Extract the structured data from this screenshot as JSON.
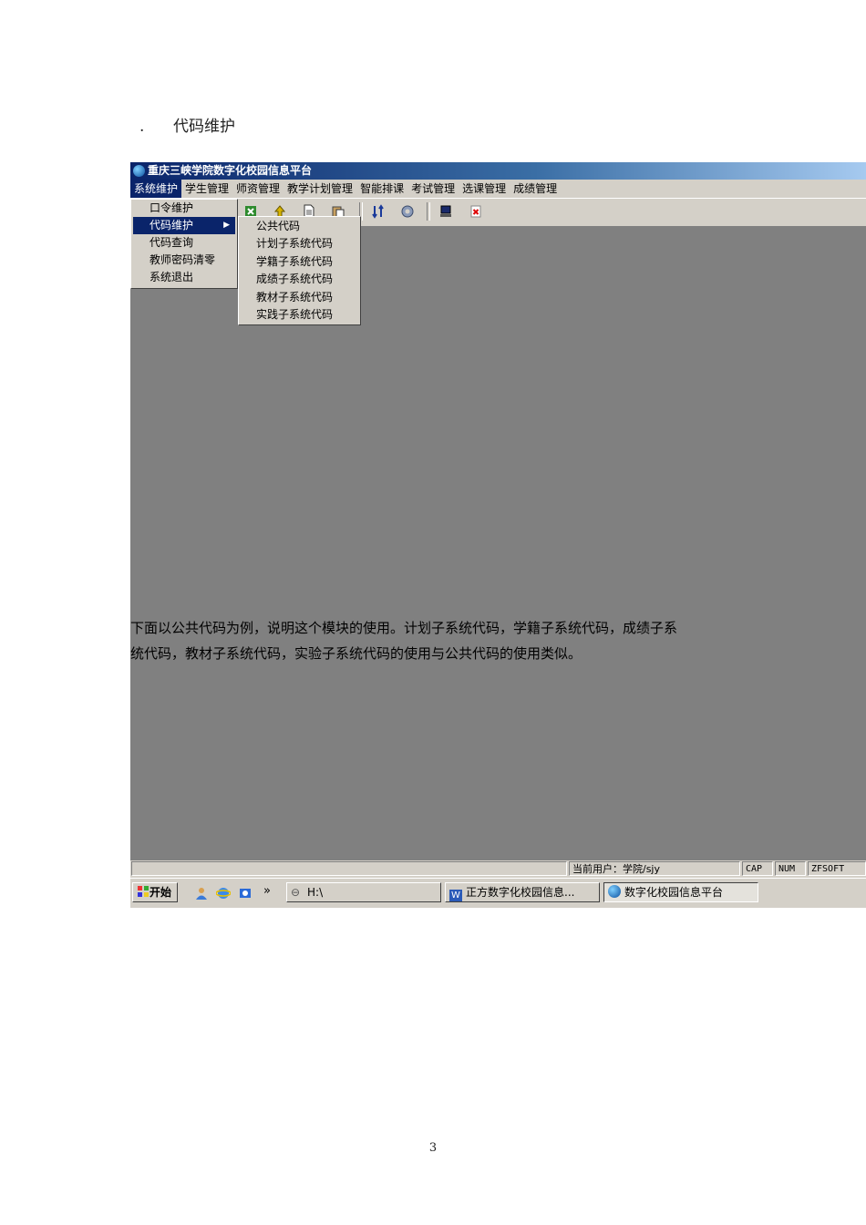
{
  "heading": {
    "number": ".",
    "text": "代码维护"
  },
  "window": {
    "title": "重庆三峡学院数字化校园信息平台"
  },
  "menubar": [
    "系统维护",
    "学生管理",
    "师资管理",
    "教学计划管理",
    "智能排课",
    "考试管理",
    "选课管理",
    "成绩管理"
  ],
  "menu1": {
    "items": [
      "口令维护",
      "代码维护",
      "代码查询",
      "教师密码清零",
      "系统退出"
    ],
    "highlighted": "代码维护"
  },
  "menu2": {
    "items": [
      "公共代码",
      "计划子系统代码",
      "学籍子系统代码",
      "成绩子系统代码",
      "教材子系统代码",
      "实践子系统代码"
    ]
  },
  "body_text": {
    "line1": "下面以公共代码为例，说明这个模块的使用。计划子系统代码，学籍子系统代码，成绩子系",
    "line2": "统代码，教材子系统代码，实验子系统代码的使用与公共代码的使用类似。"
  },
  "statusbar": {
    "user": "当前用户：学院/sjy",
    "cap": "CAP",
    "num": "NUM",
    "brand": "ZFSOFT"
  },
  "taskbar": {
    "start": "开始",
    "chevron": "»",
    "drive": "H:\\",
    "task_word": "正方数字化校园信息...",
    "task_app": "数字化校园信息平台"
  },
  "page_number": "3"
}
